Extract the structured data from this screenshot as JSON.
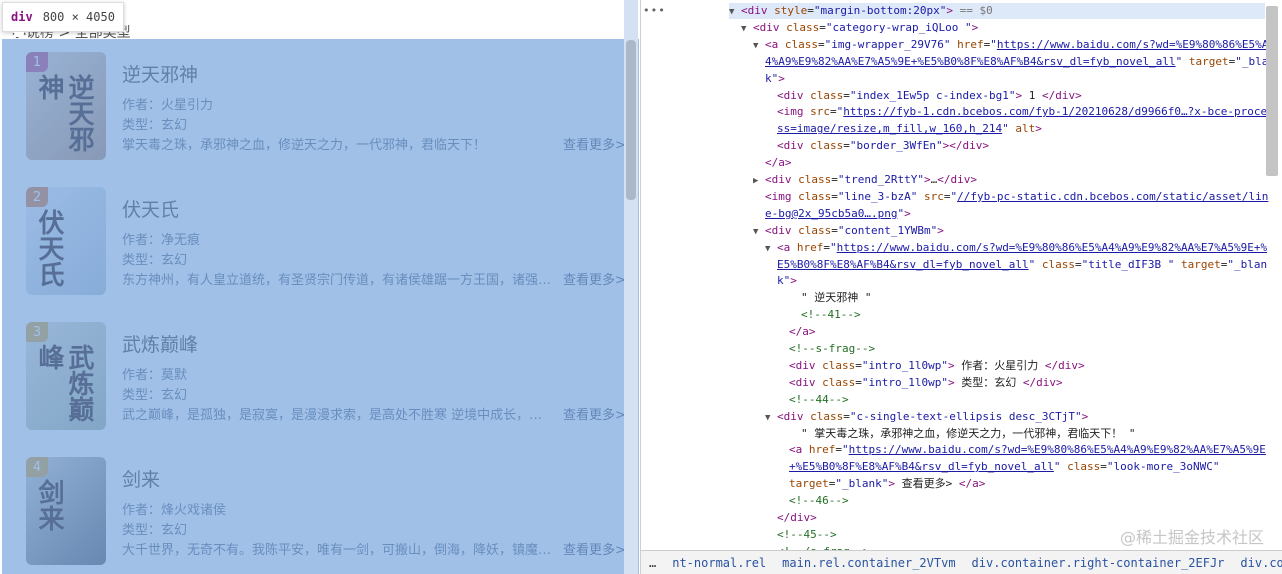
{
  "tooltip": {
    "tag": "div",
    "size": "800 × 4050"
  },
  "breadcrumb_text": "小说榜 > 全部类型",
  "books": [
    {
      "rank": "1",
      "title": "逆天邪神",
      "author": "作者：火星引力",
      "genre": "类型：玄幻",
      "desc": "掌天毒之珠，承邪神之血，修逆天之力，一代邪神，君临天下！",
      "more": "查看更多>",
      "cover_text": "逆天邪神",
      "rank_color": "#c0467a"
    },
    {
      "rank": "2",
      "title": "伏天氏",
      "author": "作者：净无痕",
      "genre": "类型：玄幻",
      "desc": "东方神州，有人皇立道统，有圣贤宗门传道，有诸侯雄踞一方王国，诸强林立",
      "more": "查看更多>",
      "cover_text": "伏天氏",
      "rank_color": "#d97a3a"
    },
    {
      "rank": "3",
      "title": "武炼巅峰",
      "author": "作者：莫默",
      "genre": "类型：玄幻",
      "desc": "武之巅峰，是孤独，是寂寞，是漫漫求索，是高处不胜寒    逆境中成长，绝境中崛起",
      "more": "查看更多>",
      "cover_text": "武炼巅峰",
      "rank_color": "#d9a03a"
    },
    {
      "rank": "4",
      "title": "剑来",
      "author": "作者：烽火戏诸侯",
      "genre": "类型：玄幻",
      "desc": "大千世界，无奇不有。我陈平安，唯有一剑，可搬山，倒海，降妖，镇魔，敕神",
      "more": "查看更多>",
      "cover_text": "剑来",
      "rank_color": "#d9a03a"
    }
  ],
  "devtools": {
    "dots": "•••",
    "lines": [
      {
        "indent": 0,
        "tri": "▼",
        "html": "<span class='tag'>&lt;div</span> <span class='attr'>style</span>=<span class='val'>\"margin-bottom:20px\"</span><span class='tag'>&gt;</span> <span class='eq'>== $0</span>",
        "sel": true
      },
      {
        "indent": 1,
        "tri": "▼",
        "html": "<span class='tag'>&lt;div</span> <span class='attr'>class</span>=<span class='val'>\"category-wrap_iQLoo \"</span><span class='tag'>&gt;</span>"
      },
      {
        "indent": 2,
        "tri": "▼",
        "html": "<span class='tag'>&lt;a</span> <span class='attr'>class</span>=<span class='val'>\"img-wrapper_29V76\"</span> <span class='attr'>href</span>=<span class='val'>\"</span><span class='link'>https://www.baidu.com/s?wd=%E9%80%86%E5%A</span>"
      },
      {
        "indent": 2,
        "tri": "",
        "html": "<span class='link'>4%A9%E9%82%AA%E7%A5%9E+%E5%B0%8F%E8%AF%B4&amp;rsv_dl=fyb_novel_all</span><span class='val'>\"</span> <span class='attr'>target</span>=<span class='val'>\"_blan</span>"
      },
      {
        "indent": 2,
        "tri": "",
        "html": "<span class='val'>k\"</span><span class='tag'>&gt;</span>"
      },
      {
        "indent": 3,
        "tri": "",
        "html": "<span class='tag'>&lt;div</span> <span class='attr'>class</span>=<span class='val'>\"index_1Ew5p c-index-bg1\"</span><span class='tag'>&gt;</span> 1 <span class='tag'>&lt;/div&gt;</span>"
      },
      {
        "indent": 3,
        "tri": "",
        "html": "<span class='tag'>&lt;img</span> <span class='attr'>src</span>=<span class='val'>\"</span><span class='link'>https://fyb-1.cdn.bcebos.com/fyb-1/20210628/d9966f0…?x-bce-proce</span>"
      },
      {
        "indent": 3,
        "tri": "",
        "html": "<span class='link'>ss=image/resize,m_fill,w_160,h_214</span><span class='val'>\"</span> <span class='attr'>alt</span><span class='tag'>&gt;</span>"
      },
      {
        "indent": 3,
        "tri": "",
        "html": "<span class='tag'>&lt;div</span> <span class='attr'>class</span>=<span class='val'>\"border_3WfEn\"</span><span class='tag'>&gt;&lt;/div&gt;</span>"
      },
      {
        "indent": 2,
        "tri": "",
        "html": "<span class='tag'>&lt;/a&gt;</span>"
      },
      {
        "indent": 2,
        "tri": "▶",
        "html": "<span class='tag'>&lt;div</span> <span class='attr'>class</span>=<span class='val'>\"trend_2RttY\"</span><span class='tag'>&gt;</span>…<span class='tag'>&lt;/div&gt;</span>"
      },
      {
        "indent": 2,
        "tri": "",
        "html": "<span class='tag'>&lt;img</span> <span class='attr'>class</span>=<span class='val'>\"line_3-bzA\"</span> <span class='attr'>src</span>=<span class='val'>\"</span><span class='link'>//fyb-pc-static.cdn.bcebos.com/static/asset/lin</span>"
      },
      {
        "indent": 2,
        "tri": "",
        "html": "<span class='link'>e-bg@2x_95cb5a0….png</span><span class='val'>\"</span><span class='tag'>&gt;</span>"
      },
      {
        "indent": 2,
        "tri": "▼",
        "html": "<span class='tag'>&lt;div</span> <span class='attr'>class</span>=<span class='val'>\"content_1YWBm\"</span><span class='tag'>&gt;</span>"
      },
      {
        "indent": 3,
        "tri": "▼",
        "html": "<span class='tag'>&lt;a</span> <span class='attr'>href</span>=<span class='val'>\"</span><span class='link'>https://www.baidu.com/s?wd=%E9%80%86%E5%A4%A9%E9%82%AA%E7%A5%9E+%</span>"
      },
      {
        "indent": 3,
        "tri": "",
        "html": "<span class='link'>E5%B0%8F%E8%AF%B4&amp;rsv_dl=fyb_novel_all</span><span class='val'>\"</span> <span class='attr'>class</span>=<span class='val'>\"title_dIF3B \"</span> <span class='attr'>target</span>=<span class='val'>\"_blan</span>"
      },
      {
        "indent": 3,
        "tri": "",
        "html": "<span class='val'>k\"</span><span class='tag'>&gt;</span>"
      },
      {
        "indent": 5,
        "tri": "",
        "html": "<span class='txt'>\" 逆天邪神 \"</span>"
      },
      {
        "indent": 5,
        "tri": "",
        "html": "<span class='cmt'>&lt;!--41--&gt;</span>"
      },
      {
        "indent": 4,
        "tri": "",
        "html": "<span class='tag'>&lt;/a&gt;</span>"
      },
      {
        "indent": 4,
        "tri": "",
        "html": "<span class='cmt'>&lt;!--s-frag--&gt;</span>"
      },
      {
        "indent": 4,
        "tri": "",
        "html": "<span class='tag'>&lt;div</span> <span class='attr'>class</span>=<span class='val'>\"intro_1l0wp\"</span><span class='tag'>&gt;</span> 作者：火星引力 <span class='tag'>&lt;/div&gt;</span>"
      },
      {
        "indent": 4,
        "tri": "",
        "html": "<span class='tag'>&lt;div</span> <span class='attr'>class</span>=<span class='val'>\"intro_1l0wp\"</span><span class='tag'>&gt;</span> 类型：玄幻 <span class='tag'>&lt;/div&gt;</span>"
      },
      {
        "indent": 4,
        "tri": "",
        "html": "<span class='cmt'>&lt;!--44--&gt;</span>"
      },
      {
        "indent": 3,
        "tri": "▼",
        "html": "<span class='tag'>&lt;div</span> <span class='attr'>class</span>=<span class='val'>\"c-single-text-ellipsis desc_3CTjT\"</span><span class='tag'>&gt;</span>"
      },
      {
        "indent": 5,
        "tri": "",
        "html": "<span class='txt'>\" 掌天毒之珠，承邪神之血，修逆天之力，一代邪神，君临天下！ \"</span>"
      },
      {
        "indent": 4,
        "tri": "",
        "html": "<span class='tag'>&lt;a</span> <span class='attr'>href</span>=<span class='val'>\"</span><span class='link'>https://www.baidu.com/s?wd=%E9%80%86%E5%A4%A9%E9%82%AA%E7%A5%9E</span>"
      },
      {
        "indent": 4,
        "tri": "",
        "html": "<span class='link'>+%E5%B0%8F%E8%AF%B4&amp;rsv_dl=fyb_novel_all</span><span class='val'>\"</span> <span class='attr'>class</span>=<span class='val'>\"look-more_3oNWC\"</span>"
      },
      {
        "indent": 4,
        "tri": "",
        "html": "<span class='attr'>target</span>=<span class='val'>\"_blank\"</span><span class='tag'>&gt;</span> 查看更多&gt; <span class='tag'>&lt;/a&gt;</span>"
      },
      {
        "indent": 4,
        "tri": "",
        "html": "<span class='cmt'>&lt;!--46--&gt;</span>"
      },
      {
        "indent": 3,
        "tri": "",
        "html": "<span class='tag'>&lt;/div&gt;</span>"
      },
      {
        "indent": 3,
        "tri": "",
        "html": "<span class='cmt'>&lt;!--45--&gt;</span>"
      },
      {
        "indent": 3,
        "tri": "",
        "html": "<span class='cmt'>&lt;!--/s-frag--&gt;</span>"
      }
    ],
    "crumbs": [
      "…",
      "nt-normal.rel",
      "main.rel.container_2VTvm",
      "div.container.right-container_2EFJr",
      "div.container-bg_lQ801",
      "div"
    ]
  },
  "watermark": "@稀土掘金技术社区"
}
